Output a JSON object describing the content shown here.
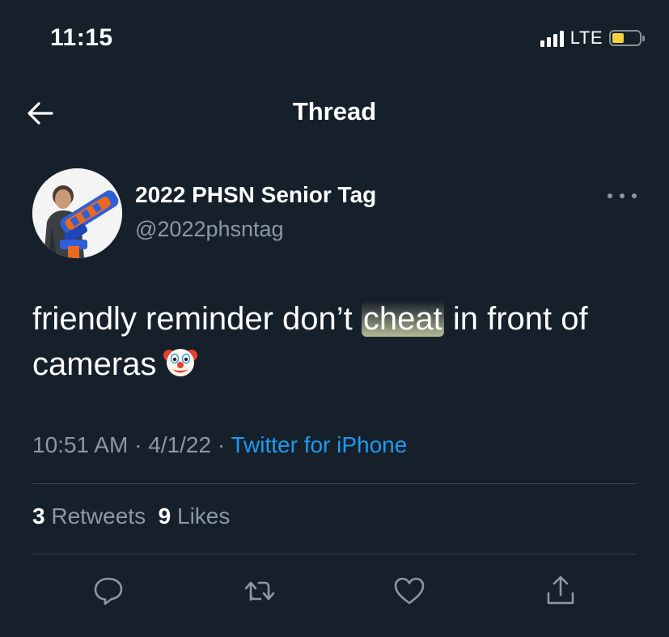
{
  "status_bar": {
    "time": "11:15",
    "network": "LTE",
    "battery_color": "#f5d33b"
  },
  "header": {
    "title": "Thread",
    "back_icon": "arrow-left-icon"
  },
  "tweet": {
    "author_name": "2022 PHSN Senior Tag",
    "author_handle": "@2022phsntag",
    "text_before": "friendly reminder don’t ",
    "text_highlight": "cheat",
    "text_after": " in front of cameras",
    "emoji": "clown-face-emoji",
    "time": "10:51 AM",
    "date": "4/1/22",
    "separator": "·",
    "source": "Twitter for iPhone",
    "retweets_count": "3",
    "retweets_label": "Retweets",
    "likes_count": "9",
    "likes_label": "Likes"
  },
  "actions": [
    {
      "icon": "reply-icon"
    },
    {
      "icon": "retweet-icon"
    },
    {
      "icon": "like-icon"
    },
    {
      "icon": "share-icon"
    }
  ],
  "colors": {
    "background": "#15202b",
    "secondary_text": "#8b98a5",
    "link": "#1d9bf0",
    "divider": "#38444d"
  }
}
